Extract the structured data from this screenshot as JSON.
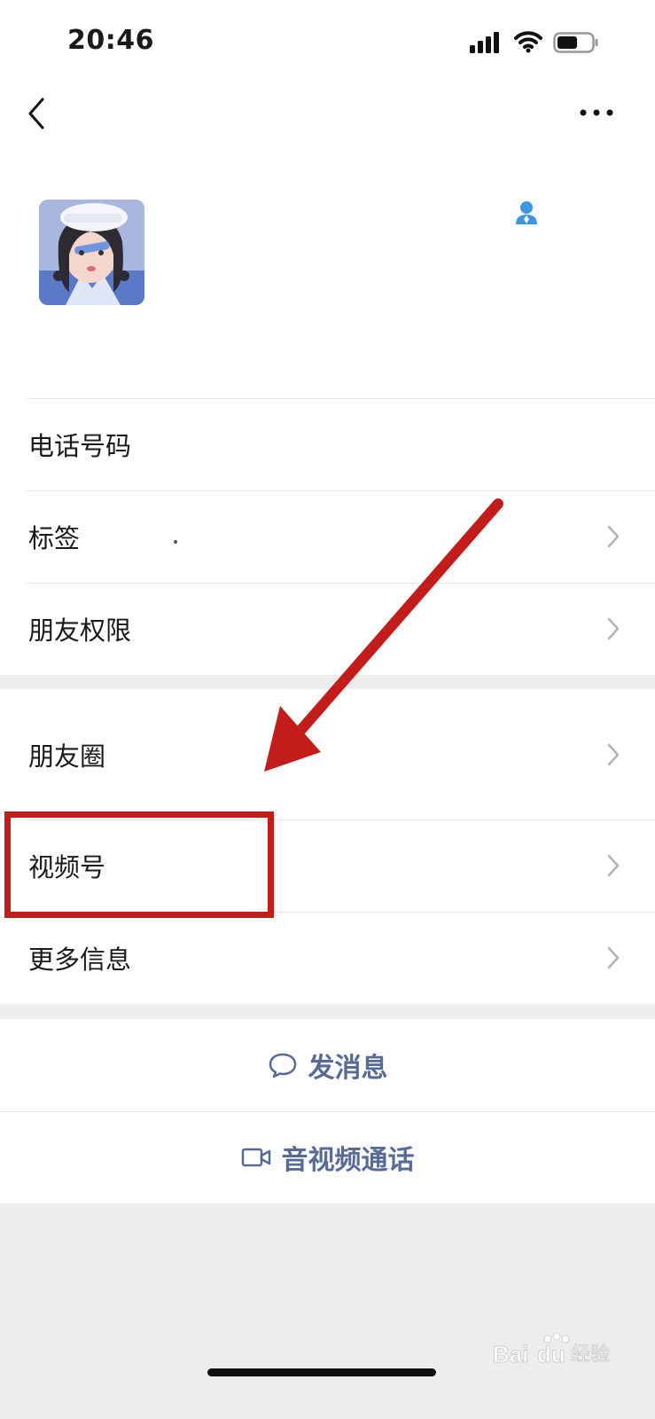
{
  "status": {
    "time": "20:46"
  },
  "list1": [
    {
      "label": "电话号码",
      "has_chevron": false
    },
    {
      "label": "标签",
      "has_chevron": true
    },
    {
      "label": "朋友权限",
      "has_chevron": true
    }
  ],
  "list2": [
    {
      "label": "朋友圈"
    },
    {
      "label": "视频号"
    },
    {
      "label": "更多信息"
    }
  ],
  "actions": {
    "message_label": "发消息",
    "call_label": "音视频通话"
  },
  "watermark": {
    "text": "Bai du 经验"
  },
  "colors": {
    "accent_link": "#576b95",
    "annotation_red": "#c21d1a",
    "background": "#ededed",
    "gender_icon": "#3e97de"
  },
  "icons": [
    "back-chevron-icon",
    "more-dots-icon",
    "gender-male-icon",
    "chevron-right-icon",
    "chat-bubble-icon",
    "video-camera-icon"
  ]
}
